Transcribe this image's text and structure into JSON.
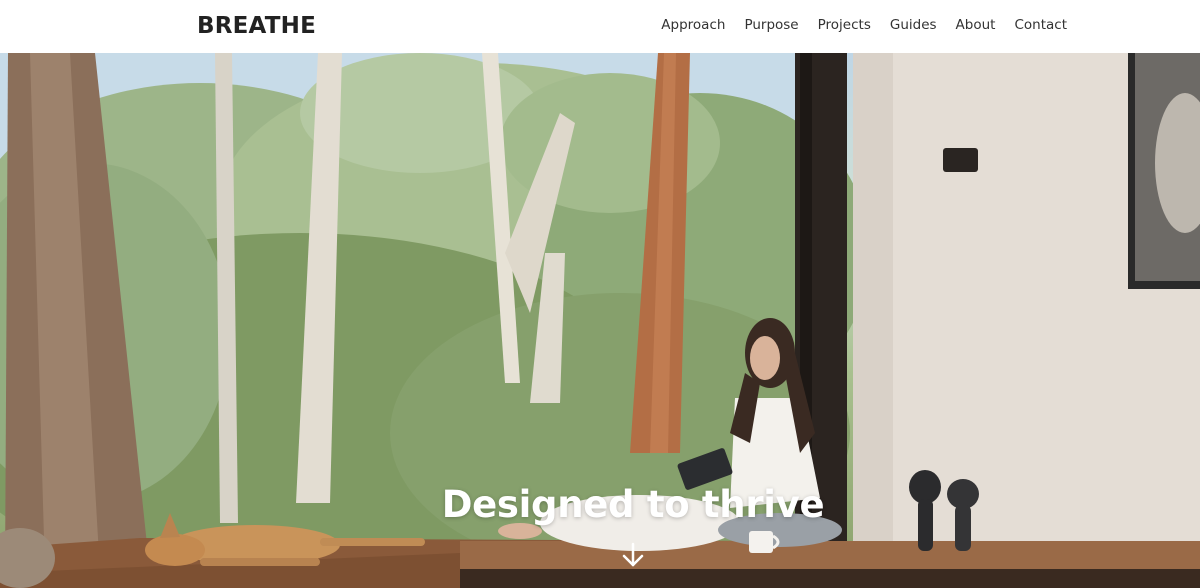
{
  "header": {
    "logo": "BREATHE",
    "nav": [
      {
        "label": "Approach"
      },
      {
        "label": "Purpose"
      },
      {
        "label": "Projects"
      },
      {
        "label": "Guides"
      },
      {
        "label": "About"
      },
      {
        "label": "Contact"
      }
    ]
  },
  "hero": {
    "headline": "Designed to thrive",
    "scroll_icon": "arrow-down-icon"
  },
  "colors": {
    "text": "#222222",
    "hero_text": "#ffffff",
    "wall": "#e4ddd5",
    "floor": "#8a5a3a"
  }
}
